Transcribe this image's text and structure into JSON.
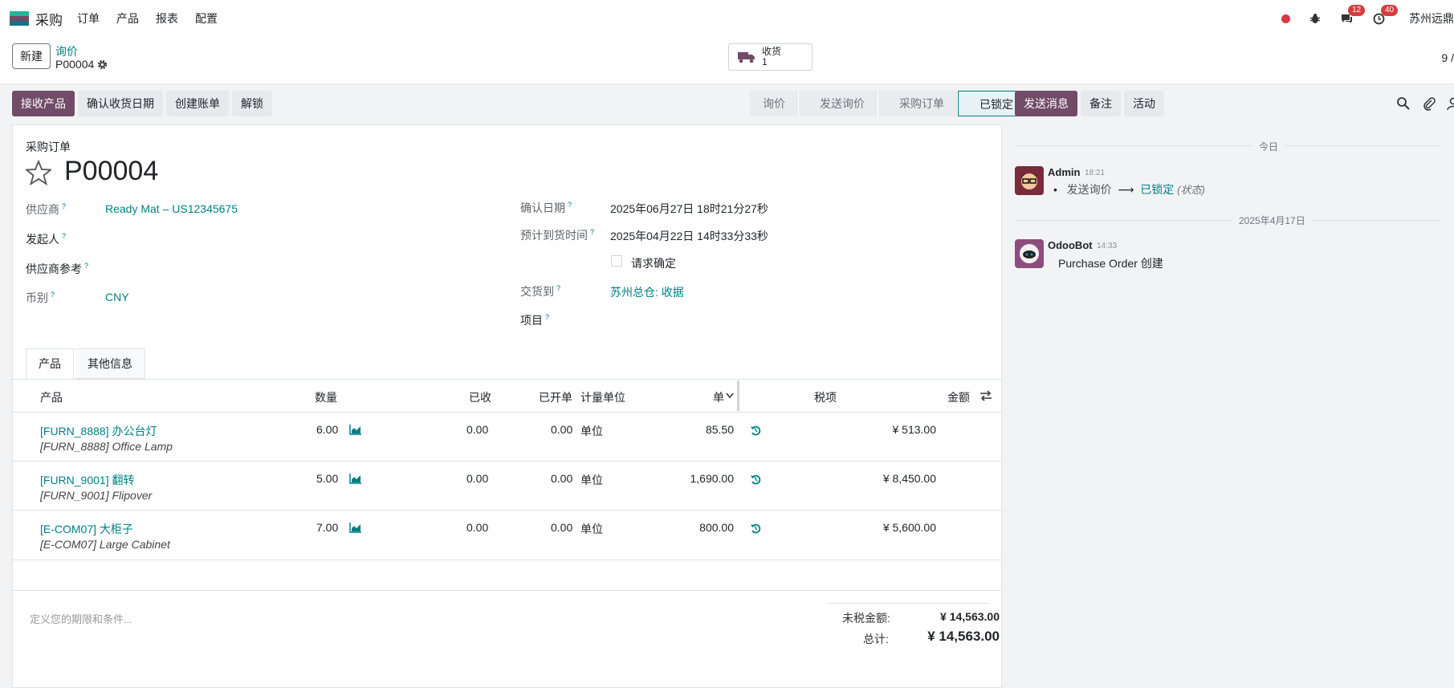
{
  "navbar": {
    "app_name": "采购",
    "menu": [
      "订单",
      "产品",
      "报表",
      "配置"
    ],
    "messages_count": "12",
    "activities_count": "40",
    "company": "苏州远鼎"
  },
  "control": {
    "new_label": "新建",
    "breadcrumb_parent": "询价",
    "breadcrumb_current": "P00004",
    "smart_button": {
      "label": "收货",
      "count": "1"
    },
    "pager": "9 /"
  },
  "actions": {
    "receive": "接收产品",
    "confirm_date": "确认收货日期",
    "create_bill": "创建账单",
    "unlock": "解锁"
  },
  "statusbar": {
    "stages": [
      "询价",
      "发送询价",
      "采购订单",
      "已锁定"
    ],
    "active": "已锁定"
  },
  "form": {
    "doc_type": "采购订单",
    "name": "P00004",
    "fields": {
      "vendor_label": "供应商",
      "vendor_value": "Ready Mat – US12345675",
      "originator_label": "发起人",
      "vendor_ref_label": "供应商参考",
      "currency_label": "币别",
      "currency_value": "CNY",
      "confirm_date_label": "确认日期",
      "confirm_date_value": "2025年06月27日 18时21分27秒",
      "expected_label": "预计到货时间",
      "expected_value": "2025年04月22日 14时33分33秒",
      "ask_confirm_label": "请求确定",
      "deliver_to_label": "交货到",
      "deliver_to_value": "苏州总仓: 收据",
      "project_label": "项目"
    },
    "tabs": [
      "产品",
      "其他信息"
    ],
    "table": {
      "headers": {
        "product": "产品",
        "qty": "数量",
        "received": "已收",
        "billed": "已开单",
        "uom": "计量单位",
        "price": "单",
        "taxes": "税项",
        "amount": "金额"
      },
      "rows": [
        {
          "product": "[FURN_8888] 办公台灯",
          "desc": "[FURN_8888] Office Lamp",
          "qty": "6.00",
          "received": "0.00",
          "billed": "0.00",
          "uom": "单位",
          "price": "85.50",
          "amount": "¥ 513.00"
        },
        {
          "product": "[FURN_9001] 翻转",
          "desc": "[FURN_9001] Flipover",
          "qty": "5.00",
          "received": "0.00",
          "billed": "0.00",
          "uom": "单位",
          "price": "1,690.00",
          "amount": "¥ 8,450.00"
        },
        {
          "product": "[E-COM07] 大柜子",
          "desc": "[E-COM07] Large Cabinet",
          "qty": "7.00",
          "received": "0.00",
          "billed": "0.00",
          "uom": "单位",
          "price": "800.00",
          "amount": "¥ 5,600.00"
        }
      ]
    },
    "terms_placeholder": "定义您的期限和条件...",
    "totals": {
      "untaxed_label": "未税金额:",
      "untaxed_value": "¥ 14,563.00",
      "total_label": "总计:",
      "total_value": "¥ 14,563.00"
    }
  },
  "chatter": {
    "send_message": "发送消息",
    "log_note": "备注",
    "activity": "活动",
    "today_label": "今日",
    "messages": [
      {
        "author": "Admin",
        "time": "18:21",
        "old_value": "发送询价",
        "new_value": "已锁定",
        "field": "(状态)"
      },
      {
        "date_label": "2025年4月17日",
        "author": "OdooBot",
        "time": "14:33",
        "body": "Purchase Order 创建"
      }
    ]
  },
  "colors": {
    "brand": "#714b67",
    "link": "#017e84",
    "badge": "#d43d3d"
  }
}
